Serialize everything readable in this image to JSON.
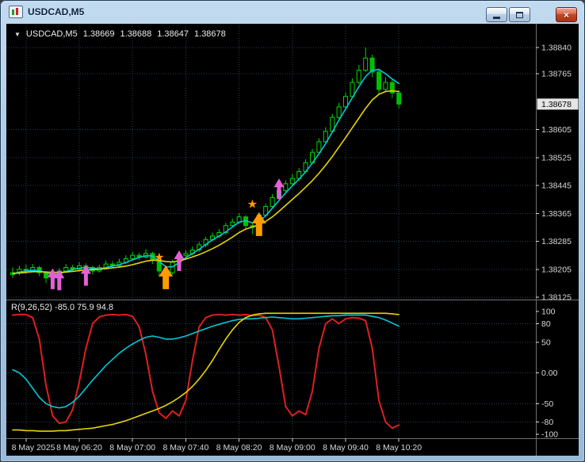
{
  "window": {
    "title": "USDCAD,M5",
    "icons": {
      "close_glyph": "×"
    }
  },
  "chart": {
    "dropdown_icon": "▼",
    "symbol": "USDCAD,M5",
    "ohlc": {
      "open": "1.38669",
      "high": "1.38688",
      "low": "1.38647",
      "close": "1.38678"
    }
  },
  "main_pane": {
    "price_axis": {
      "grid_labels": [
        "1.38840",
        "1.38765",
        "1.38605",
        "1.38525",
        "1.38445",
        "1.38365",
        "1.38285",
        "1.38205",
        "1.38125"
      ],
      "current_price": "1.38678"
    }
  },
  "indicator_pane": {
    "label": "R(9,26,52) -85.0 75.9 94.8",
    "axis_labels": [
      "100",
      "80",
      "50",
      "0.00",
      "-50",
      "-80",
      "-100"
    ]
  },
  "time_axis": {
    "labels": [
      {
        "text": "8 May 2025",
        "bar": 2
      },
      {
        "text": "8 May 06:20",
        "bar": 10
      },
      {
        "text": "8 May 07:00",
        "bar": 18
      },
      {
        "text": "8 May 07:40",
        "bar": 26
      },
      {
        "text": "8 May 08:20",
        "bar": 34
      },
      {
        "text": "8 May 09:00",
        "bar": 42
      },
      {
        "text": "8 May 09:40",
        "bar": 50
      },
      {
        "text": "8 May 10:20",
        "bar": 58
      }
    ]
  },
  "colors": {
    "background": "#000000",
    "grid": "#2a3c52",
    "axis_text": "#d8d8d8",
    "separator": "#6f6f6f",
    "candle_up": "#00d800",
    "candle_down": "#00c000",
    "ma_fast": "#00c8d8",
    "ma_slow": "#e8d400",
    "osc_main": "#df1f1f",
    "osc_fast": "#00c8d8",
    "osc_slow": "#e8d400",
    "signal_pink": "#e45fd5",
    "signal_orange": "#ff9c00",
    "current_tag_bg": "#e4e4e4",
    "current_tag_text": "#000000"
  },
  "chart_data": {
    "type": "candlestick",
    "symbol": "USDCAD",
    "timeframe": "M5",
    "price_range": [
      1.38125,
      1.3884
    ],
    "candles": [
      [
        1.3819,
        1.3821,
        1.3818,
        1.38195
      ],
      [
        1.38195,
        1.38215,
        1.38188,
        1.38205
      ],
      [
        1.38205,
        1.38218,
        1.38192,
        1.382
      ],
      [
        1.382,
        1.3822,
        1.38195,
        1.3821
      ],
      [
        1.3821,
        1.38215,
        1.38185,
        1.38195
      ],
      [
        1.38195,
        1.382,
        1.38165,
        1.3818
      ],
      [
        1.3818,
        1.38198,
        1.3817,
        1.3819
      ],
      [
        1.3819,
        1.38208,
        1.38182,
        1.382
      ],
      [
        1.382,
        1.3822,
        1.38195,
        1.3821
      ],
      [
        1.3821,
        1.38218,
        1.38198,
        1.38205
      ],
      [
        1.38205,
        1.38225,
        1.38198,
        1.38215
      ],
      [
        1.38215,
        1.38222,
        1.382,
        1.3821
      ],
      [
        1.3821,
        1.38215,
        1.3819,
        1.382
      ],
      [
        1.382,
        1.38218,
        1.38195,
        1.3821
      ],
      [
        1.3821,
        1.3823,
        1.38205,
        1.3822
      ],
      [
        1.3822,
        1.38228,
        1.38208,
        1.38215
      ],
      [
        1.38215,
        1.38235,
        1.3821,
        1.38225
      ],
      [
        1.38225,
        1.38245,
        1.3822,
        1.38235
      ],
      [
        1.38235,
        1.38255,
        1.3823,
        1.38245
      ],
      [
        1.38245,
        1.38252,
        1.38232,
        1.3824
      ],
      [
        1.3824,
        1.38262,
        1.38235,
        1.3825
      ],
      [
        1.3825,
        1.38255,
        1.3822,
        1.3823
      ],
      [
        1.3823,
        1.38235,
        1.38185,
        1.382
      ],
      [
        1.382,
        1.3821,
        1.3818,
        1.38195
      ],
      [
        1.38195,
        1.38232,
        1.3819,
        1.38225
      ],
      [
        1.38225,
        1.38252,
        1.38218,
        1.38245
      ],
      [
        1.38245,
        1.3826,
        1.38238,
        1.3825
      ],
      [
        1.3825,
        1.3827,
        1.38245,
        1.3826
      ],
      [
        1.3826,
        1.38283,
        1.38255,
        1.38275
      ],
      [
        1.38275,
        1.38298,
        1.38268,
        1.3829
      ],
      [
        1.3829,
        1.3831,
        1.38285,
        1.383
      ],
      [
        1.383,
        1.3832,
        1.38295,
        1.3831
      ],
      [
        1.3831,
        1.38338,
        1.38305,
        1.3833
      ],
      [
        1.3833,
        1.3835,
        1.38325,
        1.3834
      ],
      [
        1.3834,
        1.38365,
        1.38335,
        1.38355
      ],
      [
        1.38355,
        1.3836,
        1.38318,
        1.3833
      ],
      [
        1.3833,
        1.3834,
        1.38305,
        1.38325
      ],
      [
        1.38325,
        1.38368,
        1.3832,
        1.3836
      ],
      [
        1.3836,
        1.38393,
        1.38355,
        1.38385
      ],
      [
        1.38385,
        1.3842,
        1.3838,
        1.3841
      ],
      [
        1.3841,
        1.3844,
        1.38405,
        1.3843
      ],
      [
        1.3843,
        1.3846,
        1.38425,
        1.3845
      ],
      [
        1.3845,
        1.38478,
        1.38445,
        1.38465
      ],
      [
        1.38465,
        1.38495,
        1.38458,
        1.38485
      ],
      [
        1.38485,
        1.3852,
        1.3848,
        1.3851
      ],
      [
        1.3851,
        1.3855,
        1.38505,
        1.3854
      ],
      [
        1.3854,
        1.3858,
        1.38532,
        1.3857
      ],
      [
        1.3857,
        1.38612,
        1.38565,
        1.386
      ],
      [
        1.386,
        1.3865,
        1.38595,
        1.3864
      ],
      [
        1.3864,
        1.38682,
        1.38635,
        1.3867
      ],
      [
        1.3867,
        1.38712,
        1.3866,
        1.387
      ],
      [
        1.387,
        1.38752,
        1.38695,
        1.3874
      ],
      [
        1.3874,
        1.3879,
        1.38735,
        1.38775
      ],
      [
        1.38775,
        1.3884,
        1.3877,
        1.3881
      ],
      [
        1.3881,
        1.3882,
        1.38755,
        1.3877
      ],
      [
        1.3877,
        1.3878,
        1.38705,
        1.3872
      ],
      [
        1.3872,
        1.38755,
        1.38712,
        1.3874
      ],
      [
        1.3874,
        1.38748,
        1.38695,
        1.3871
      ],
      [
        1.3871,
        1.38718,
        1.38665,
        1.38678
      ]
    ],
    "overlays": [
      {
        "name": "ma-fast",
        "color_key": "ma_fast",
        "values": [
          1.38192,
          1.38197,
          1.382,
          1.38202,
          1.38201,
          1.38195,
          1.3819,
          1.38192,
          1.38198,
          1.38204,
          1.38208,
          1.3821,
          1.38208,
          1.38206,
          1.3821,
          1.38214,
          1.38218,
          1.38224,
          1.38232,
          1.38239,
          1.38244,
          1.38243,
          1.38228,
          1.38212,
          1.38212,
          1.38224,
          1.38238,
          1.3825,
          1.38262,
          1.38276,
          1.38289,
          1.383,
          1.38312,
          1.38326,
          1.3834,
          1.38344,
          1.38338,
          1.38342,
          1.38358,
          1.3838,
          1.38402,
          1.38424,
          1.38444,
          1.38463,
          1.38484,
          1.38509,
          1.38536,
          1.38565,
          1.38598,
          1.38632,
          1.38664,
          1.38696,
          1.38728,
          1.38757,
          1.38775,
          1.38777,
          1.38765,
          1.3875,
          1.38737
        ]
      },
      {
        "name": "ma-slow",
        "color_key": "ma_slow",
        "values": [
          1.38193,
          1.38194,
          1.38196,
          1.38198,
          1.38198,
          1.38197,
          1.38196,
          1.38196,
          1.38197,
          1.38199,
          1.38201,
          1.38203,
          1.38204,
          1.38205,
          1.38207,
          1.38209,
          1.38211,
          1.38214,
          1.38218,
          1.38223,
          1.38228,
          1.38231,
          1.3823,
          1.38227,
          1.38226,
          1.38229,
          1.38234,
          1.3824,
          1.38247,
          1.38255,
          1.38264,
          1.38274,
          1.38285,
          1.38297,
          1.3831,
          1.3832,
          1.38326,
          1.38332,
          1.38342,
          1.38355,
          1.38371,
          1.38388,
          1.38405,
          1.38422,
          1.3844,
          1.38459,
          1.3848,
          1.38503,
          1.38528,
          1.38555,
          1.38582,
          1.3861,
          1.38638,
          1.38666,
          1.3869,
          1.38706,
          1.38714,
          1.38716,
          1.38714
        ]
      }
    ],
    "signals": [
      {
        "shape": "arrow",
        "size": "small",
        "color_key": "signal_pink",
        "bar": 6,
        "price": 1.38148
      },
      {
        "shape": "arrow",
        "size": "small",
        "color_key": "signal_pink",
        "bar": 7,
        "price": 1.38145
      },
      {
        "shape": "arrow",
        "size": "small",
        "color_key": "signal_pink",
        "bar": 11,
        "price": 1.38158
      },
      {
        "shape": "star",
        "size": "small",
        "color_key": "signal_orange",
        "bar": 22,
        "price": 1.3824
      },
      {
        "shape": "arrow",
        "size": "large",
        "color_key": "signal_orange",
        "bar": 23,
        "price": 1.38148
      },
      {
        "shape": "arrow",
        "size": "small",
        "color_key": "signal_pink",
        "bar": 25,
        "price": 1.382
      },
      {
        "shape": "star",
        "size": "small",
        "color_key": "signal_orange",
        "bar": 36,
        "price": 1.38392
      },
      {
        "shape": "arrow",
        "size": "large",
        "color_key": "signal_orange",
        "bar": 37,
        "price": 1.383
      },
      {
        "shape": "arrow",
        "size": "small",
        "color_key": "signal_pink",
        "bar": 40,
        "price": 1.38406
      }
    ],
    "oscillator": {
      "name": "R(9,26,52)",
      "display_values": "-85.0 75.9 94.8",
      "range": [
        -100,
        100
      ],
      "levels": [
        100,
        80,
        50,
        0,
        -50,
        -80,
        -100
      ],
      "series": [
        {
          "name": "main",
          "color_key": "osc_main",
          "values": [
            94,
            95,
            95,
            90,
            55,
            -20,
            -70,
            -82,
            -80,
            -60,
            -15,
            40,
            80,
            91,
            94,
            95,
            94,
            95,
            92,
            75,
            30,
            -30,
            -65,
            -74,
            -62,
            -70,
            -45,
            20,
            75,
            90,
            94,
            95,
            94,
            95,
            94,
            95,
            93,
            94,
            90,
            70,
            10,
            -55,
            -70,
            -62,
            -68,
            -30,
            40,
            80,
            88,
            80,
            88,
            90,
            89,
            85,
            40,
            -45,
            -80,
            -90,
            -85
          ]
        },
        {
          "name": "fast",
          "color_key": "osc_fast",
          "values": [
            5,
            0,
            -10,
            -25,
            -40,
            -50,
            -55,
            -57,
            -55,
            -48,
            -38,
            -25,
            -12,
            0,
            12,
            22,
            32,
            40,
            47,
            53,
            58,
            60,
            58,
            55,
            55,
            57,
            60,
            64,
            68,
            72,
            76,
            79,
            82,
            85,
            87,
            88,
            88,
            89,
            90,
            91,
            90,
            89,
            88,
            88,
            89,
            90,
            91,
            92,
            93,
            93,
            94,
            94,
            94,
            94,
            92,
            90,
            86,
            81,
            76
          ]
        },
        {
          "name": "slow",
          "color_key": "osc_slow",
          "values": [
            -93,
            -93,
            -94,
            -94,
            -95,
            -95,
            -95,
            -94,
            -94,
            -93,
            -92,
            -91,
            -90,
            -88,
            -86,
            -84,
            -81,
            -78,
            -74,
            -70,
            -66,
            -62,
            -58,
            -53,
            -47,
            -40,
            -32,
            -22,
            -10,
            4,
            20,
            38,
            55,
            70,
            82,
            90,
            94,
            96,
            97,
            97,
            97,
            97,
            97,
            97,
            97,
            97,
            97,
            97,
            97,
            97,
            97,
            97,
            97,
            97,
            97,
            97,
            97,
            96,
            95
          ]
        }
      ]
    }
  }
}
